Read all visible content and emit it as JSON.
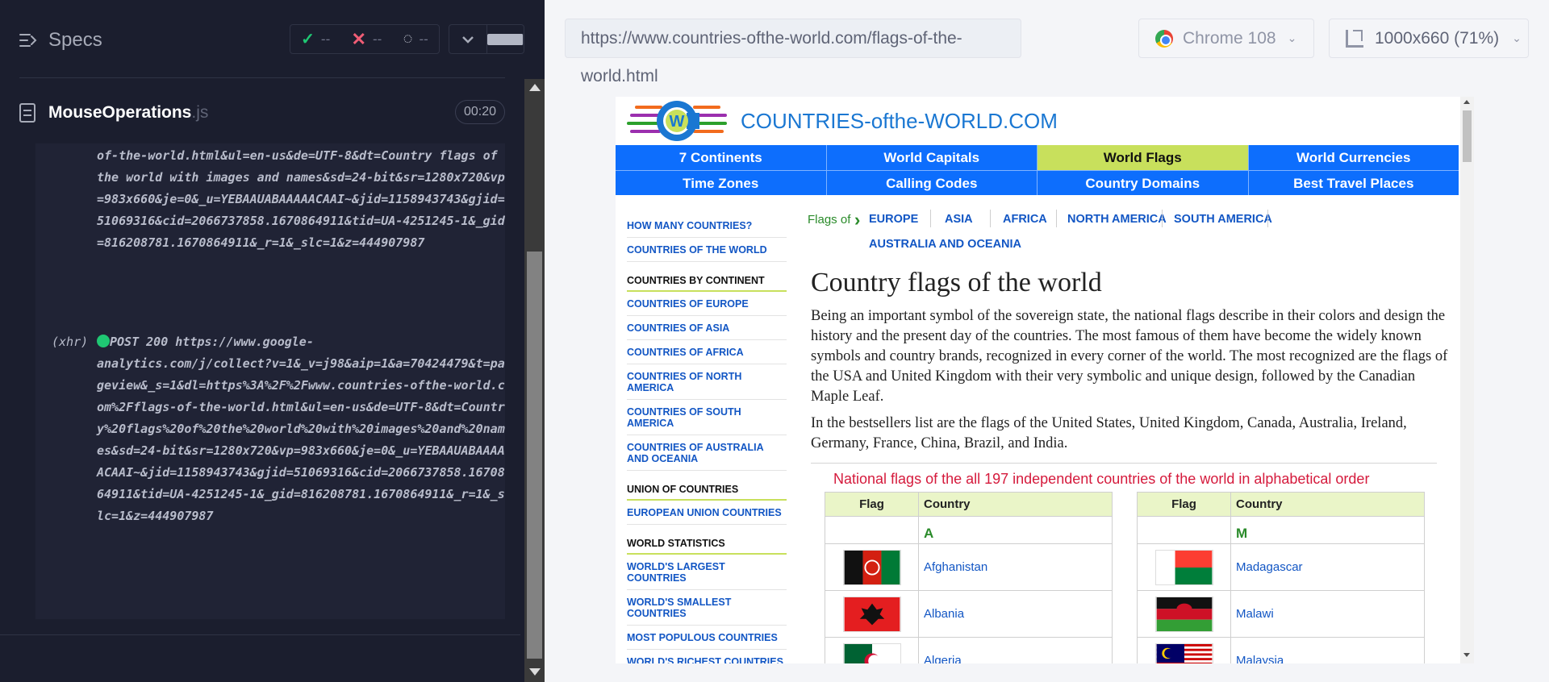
{
  "runner": {
    "specs_label": "Specs",
    "stats": {
      "passed": "--",
      "failed": "--",
      "pending": "--"
    },
    "spec": {
      "name": "MouseOperations",
      "ext": ".js",
      "time": "00:20"
    },
    "log": {
      "block1": "of-the-world.html&ul=en-us&de=UTF-8&dt=Country flags of the world with images and names&sd=24-bit&sr=1280x720&vp=983x660&je=0&_u=YEBAAUABAAAAACAAI~&jid=1158943743&gjid=51069316&cid=2066737858.1670864911&tid=UA-4251245-1&_gid=816208781.1670864911&_r=1&_slc=1&z=444907987",
      "xhr_prefix": "(xhr)",
      "block2_first": "POST 200 https://www.google-",
      "block2": "analytics.com/j/collect?v=1&_v=j98&aip=1&a=70424479&t=pageview&_s=1&dl=https%3A%2F%2Fwww.countries-ofthe-world.com%2Fflags-of-the-world.html&ul=en-us&de=UTF-8&dt=Country%20flags%20of%20the%20world%20with%20images%20and%20names&sd=24-bit&sr=1280x720&vp=983x660&je=0&_u=YEBAAUABAAAAACAAI~&jid=1158943743&gjid=51069316&cid=2066737858.1670864911&tid=UA-4251245-1&_gid=816208781.1670864911&_r=1&_slc=1&z=444907987"
    }
  },
  "aut": {
    "url": "https://www.countries-ofthe-world.com/flags-of-the-world.html",
    "browser": "Chrome 108",
    "viewport": "1000x660",
    "zoom": "(71%)"
  },
  "site": {
    "name": "COUNTRIES-ofthe-WORLD.COM",
    "menu_row1": [
      "7 Continents",
      "World Capitals",
      "World Flags",
      "World Currencies"
    ],
    "menu_row2": [
      "Time Zones",
      "Calling Codes",
      "Country Domains",
      "Best Travel Places"
    ],
    "sidebar": {
      "link1": "HOW MANY COUNTRIES?",
      "link2": "COUNTRIES OF THE WORLD",
      "head1": "COUNTRIES BY CONTINENT",
      "link3": "COUNTRIES OF EUROPE",
      "link4": "COUNTRIES OF ASIA",
      "link5": "COUNTRIES OF AFRICA",
      "link6": "COUNTRIES OF NORTH AMERICA",
      "link7": "COUNTRIES OF SOUTH AMERICA",
      "link8": "COUNTRIES OF AUSTRALIA AND OCEANIA",
      "head2": "UNION OF COUNTRIES",
      "link9": "EUROPEAN UNION COUNTRIES",
      "head3": "WORLD STATISTICS",
      "link10": "WORLD'S LARGEST COUNTRIES",
      "link11": "WORLD'S SMALLEST COUNTRIES",
      "link12": "MOST POPULOUS COUNTRIES",
      "link13": "WORLD'S RICHEST COUNTRIES"
    },
    "flags_nav": {
      "label": "Flags of",
      "europe": "EUROPE",
      "asia": "ASIA",
      "africa": "AFRICA",
      "north_america": "NORTH AMERICA",
      "south_america": "SOUTH AMERICA",
      "oceania": "AUSTRALIA AND OCEANIA"
    },
    "heading": "Country flags of the world",
    "para1": "Being an important symbol of the sovereign state, the national flags describe in their colors and design the history and the present day of the countries. The most famous of them have become the widely known symbols and country brands, recognized in every corner of the world. The most recognized are the flags of the USA and United Kingdom with their very symbolic and unique design, followed by the Canadian Maple Leaf.",
    "para2": "In the bestsellers list are the flags of the United States, United Kingdom, Canada, Australia, Ireland, Germany, France, China, Brazil, and India.",
    "table_title": "National flags of the all 197 independent countries of the world in alphabetical order",
    "table_headers": {
      "flag": "Flag",
      "country": "Country"
    },
    "table_left": {
      "letter": "A",
      "rows": [
        "Afghanistan",
        "Albania",
        "Algeria"
      ]
    },
    "table_right": {
      "letter": "M",
      "rows": [
        "Madagascar",
        "Malawi",
        "Malaysia"
      ]
    }
  }
}
